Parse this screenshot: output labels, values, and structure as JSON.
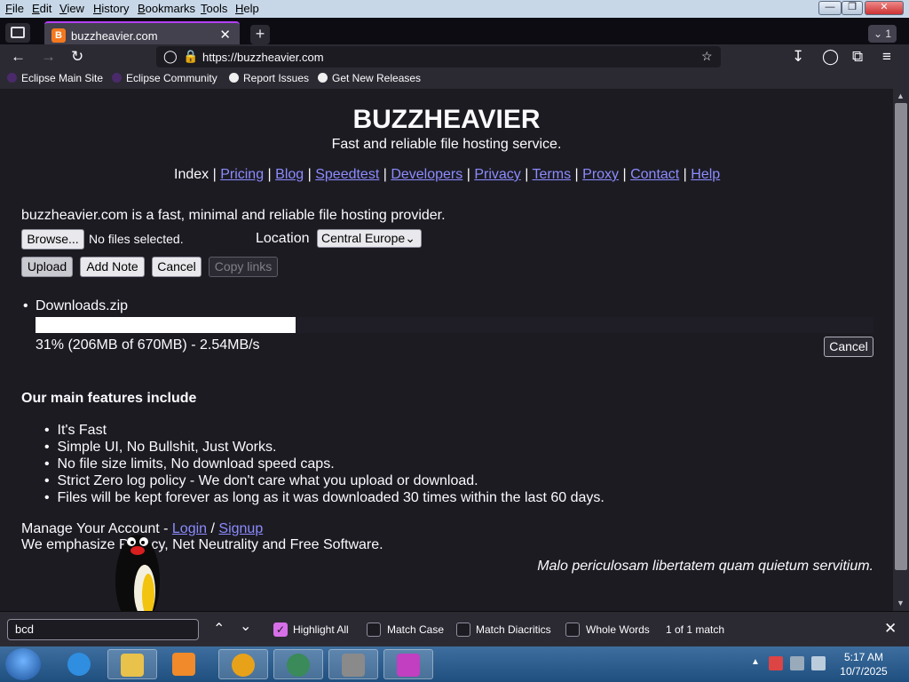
{
  "menubar": {
    "items": [
      "File",
      "Edit",
      "View",
      "History",
      "Bookmarks",
      "Tools",
      "Help"
    ]
  },
  "tab": {
    "title": "buzzheavier.com",
    "favicon_letter": "B"
  },
  "tab_count": "1",
  "navbar": {
    "url": "https://buzzheavier.com"
  },
  "bookmarks": [
    {
      "label": "Eclipse Main Site",
      "icon": "eclipse-icon"
    },
    {
      "label": "Eclipse Community",
      "icon": "eclipse-icon"
    },
    {
      "label": "Report Issues",
      "icon": "github-icon"
    },
    {
      "label": "Get New Releases",
      "icon": "github-icon"
    }
  ],
  "site": {
    "title": "BUZZHEAVIER",
    "tagline": "Fast and reliable file hosting service.",
    "nav_current": "Index",
    "nav_links": [
      "Pricing",
      "Blog",
      "Speedtest",
      "Developers",
      "Privacy",
      "Terms",
      "Proxy",
      "Contact",
      "Help"
    ],
    "intro": "buzzheavier.com is a fast, minimal and reliable file hosting provider.",
    "browse_label": "Browse...",
    "no_files": "No files selected.",
    "location_label": "Location",
    "location_value": "Central Europe",
    "buttons": {
      "upload": "Upload",
      "add_note": "Add Note",
      "cancel": "Cancel",
      "copy_links": "Copy links"
    },
    "upload_item": {
      "filename": "Downloads.zip",
      "progress": 0.31,
      "status": "31% (206MB of 670MB) - 2.54MB/s",
      "cancel_label": "Cancel"
    },
    "features_heading": "Our main features include",
    "features": [
      "It's Fast",
      "Simple UI, No Bullshit, Just Works.",
      "No file size limits, No download speed caps.",
      "Strict Zero log policy - We don't care what you upload or download.",
      "Files will be kept forever as long as it was downloaded 30 times within the last 60 days."
    ],
    "account_prefix": "Manage Your Account - ",
    "login": "Login",
    "signup": "Signup",
    "emphasize": "We emphasize Privacy, Net Neutrality and Free Software.",
    "motto": "Malo periculosam libertatem quam quietum servitium."
  },
  "findbar": {
    "query": "bcd",
    "highlight_all": "Highlight All",
    "match_case": "Match Case",
    "match_diacritics": "Match Diacritics",
    "whole_words": "Whole Words",
    "result": "1 of 1 match"
  },
  "taskbar": {
    "time": "5:17 AM",
    "date": "10/7/2025"
  },
  "colors": {
    "accent": "#b43fff",
    "link": "#8c8cff",
    "check": "#d76fe8"
  }
}
